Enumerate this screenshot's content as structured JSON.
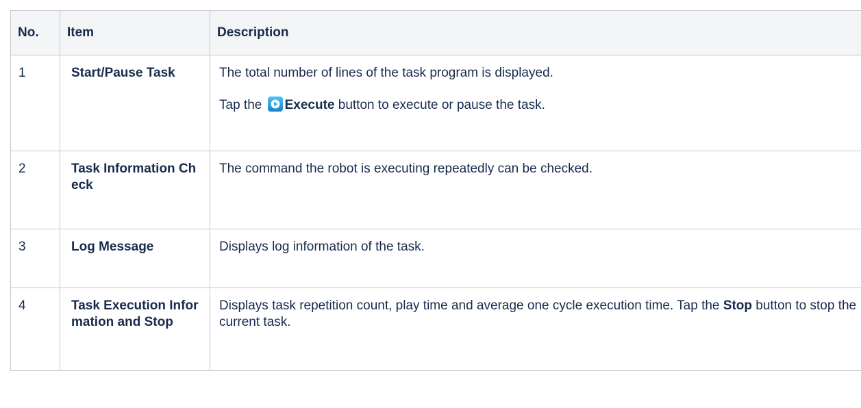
{
  "table": {
    "headers": {
      "no": "No.",
      "item": "Item",
      "description": "Description"
    },
    "rows": [
      {
        "no": "1",
        "item": "Start/Pause Task",
        "desc_line1": "The total number of lines of the task program is displayed.",
        "desc_line2_pre": "Tap the",
        "desc_line2_bold": "Execute",
        "desc_line2_post": "button to execute or pause the task.",
        "icon": "play-icon"
      },
      {
        "no": "2",
        "item": "Task Information Check",
        "desc": "The command the robot is executing repeatedly can be checked."
      },
      {
        "no": "3",
        "item": "Log Message",
        "desc": "Displays log information of the task."
      },
      {
        "no": "4",
        "item": "Task Execution Information and Stop",
        "desc_pre": "Displays task repetition count, play time and average one cycle execution time. Tap the",
        "desc_bold": "Stop",
        "desc_post": "button to stop the current task."
      }
    ]
  },
  "colors": {
    "border": "#c1c7d0",
    "header_bg": "#f4f5f7",
    "text": "#172b4d",
    "icon_blue": "#1e9be0"
  }
}
